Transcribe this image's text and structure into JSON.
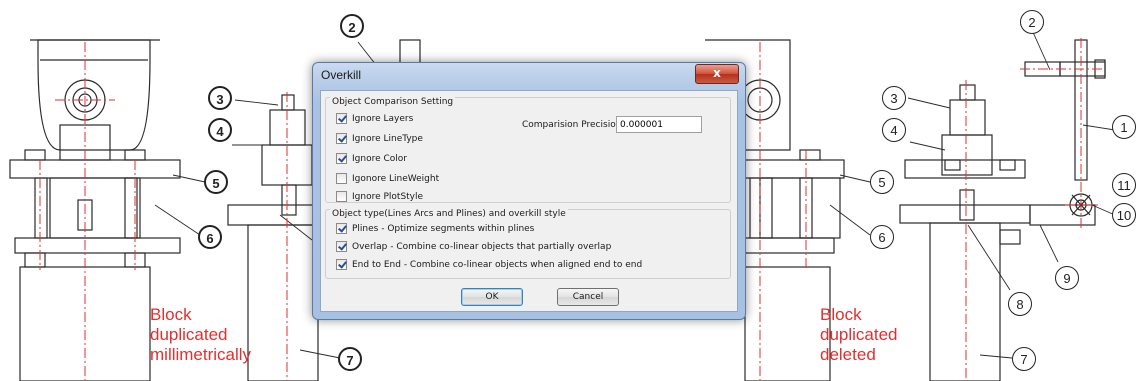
{
  "dialog": {
    "title": "Overkill",
    "close_label": "x",
    "comparison_group_title": "Object Comparison Setting",
    "checkboxes": [
      {
        "label": "Ignore Layers",
        "checked": true
      },
      {
        "label": "Ignore LineType",
        "checked": true
      },
      {
        "label": "Ignore Color",
        "checked": true
      },
      {
        "label": "Igonore LineWeight",
        "checked": false
      },
      {
        "label": "Ignore PlotStyle",
        "checked": false
      }
    ],
    "precision_label": "Comparision Precision:",
    "precision_value": "0.000001",
    "style_group_title": "Object type(Lines Arcs and Plines) and overkill style",
    "style_options": [
      {
        "label": "Plines - Optimize segments within plines",
        "checked": true
      },
      {
        "label": "Overlap - Combine co-linear objects that partially overlap",
        "checked": true
      },
      {
        "label": "End to End - Combine co-linear objects when aligned end to end",
        "checked": true
      }
    ],
    "ok_label": "OK",
    "cancel_label": "Cancel"
  },
  "drawing": {
    "left_callouts": [
      "2",
      "3",
      "4",
      "5",
      "6",
      "7"
    ],
    "right_callouts": [
      "2",
      "3",
      "4",
      "1",
      "5",
      "11",
      "6",
      "10",
      "9",
      "8",
      "7"
    ],
    "left_note": [
      "Block",
      "duplicated",
      "millimetrically"
    ],
    "right_note": [
      "Block",
      "duplicated",
      "deleted"
    ]
  },
  "colors": {
    "annotation": "#e03030",
    "centerline": "#e03030",
    "dialog_frame": "#a8c1e1",
    "close_button": "#c8402a"
  }
}
